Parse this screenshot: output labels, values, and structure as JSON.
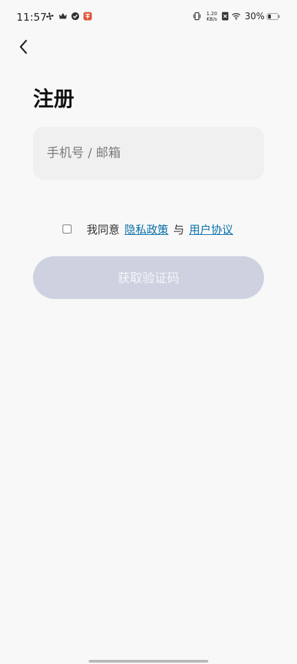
{
  "status_bar": {
    "time": "11:57",
    "net_speed_value": "1.20",
    "net_speed_unit": "KB/s",
    "battery_percent": "30%",
    "battery_level": 0.3,
    "icons": [
      "fan-icon",
      "crown-icon",
      "check-badge-icon",
      "app-badge-icon",
      "vibrate-icon",
      "sim-disabled-icon",
      "wifi-icon",
      "battery-icon"
    ]
  },
  "header": {
    "back_icon": "chevron-left-icon"
  },
  "page": {
    "title": "注册"
  },
  "form": {
    "account_placeholder": "手机号 / 邮箱",
    "account_value": ""
  },
  "agreement": {
    "checked": false,
    "prefix": "我同意",
    "privacy_link": "隐私政策",
    "joiner": "与",
    "terms_link": "用户协议"
  },
  "actions": {
    "get_code_label": "获取验证码",
    "enabled": false
  },
  "colors": {
    "background": "#f8f8f8",
    "input_background": "#f0f0f0",
    "link": "#0a6fa8",
    "button_disabled": "#ced2e0"
  }
}
